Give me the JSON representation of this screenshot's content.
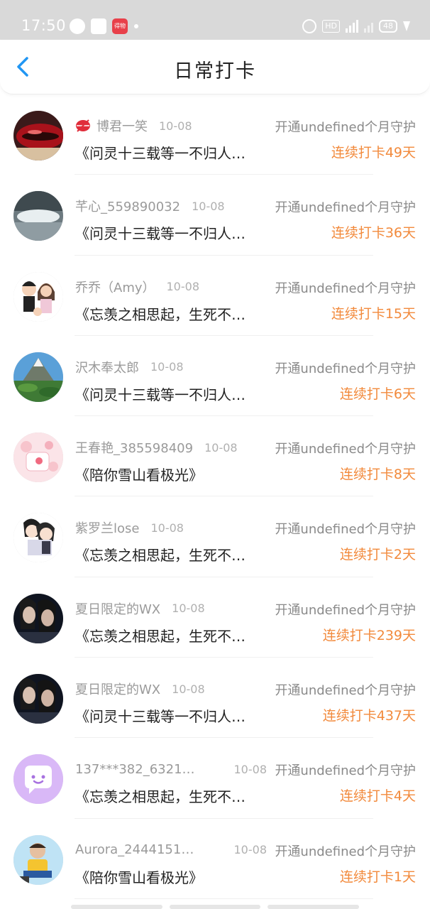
{
  "status_bar": {
    "time": "17:50",
    "hd_label": "HD",
    "battery": "48",
    "notif3_label": "得物"
  },
  "header": {
    "title": "日常打卡"
  },
  "colors": {
    "streak": "#f28a3c",
    "back_arrow": "#2196f3",
    "title": "#222222"
  },
  "items": [
    {
      "username": "博君一笑",
      "date": "10-08",
      "guard": "开通undefined个月守护",
      "book": "《问灵十三载等一不归人…",
      "streak": "连续打卡49天",
      "badge": "lips-icon"
    },
    {
      "username": "芊心_559890032",
      "date": "10-08",
      "guard": "开通undefined个月守护",
      "book": "《问灵十三载等一不归人…",
      "streak": "连续打卡36天"
    },
    {
      "username": "乔乔（Amy）",
      "date": "10-08",
      "guard": "开通undefined个月守护",
      "book": "《忘羡之相思起，生死不…",
      "streak": "连续打卡15天"
    },
    {
      "username": "沢木奉太郎",
      "date": "10-08",
      "guard": "开通undefined个月守护",
      "book": "《问灵十三载等一不归人…",
      "streak": "连续打卡6天"
    },
    {
      "username": "王春艳_385598409",
      "date": "10-08",
      "guard": "开通undefined个月守护",
      "book": "《陪你雪山看极光》",
      "streak": "连续打卡8天"
    },
    {
      "username": "紫罗兰lose",
      "date": "10-08",
      "guard": "开通undefined个月守护",
      "book": "《忘羡之相思起，生死不…",
      "streak": "连续打卡2天"
    },
    {
      "username": "夏日限定的WX",
      "date": "10-08",
      "guard": "开通undefined个月守护",
      "book": "《忘羡之相思起，生死不…",
      "streak": "连续打卡239天"
    },
    {
      "username": "夏日限定的WX",
      "date": "10-08",
      "guard": "开通undefined个月守护",
      "book": "《问灵十三载等一不归人…",
      "streak": "连续打卡437天"
    },
    {
      "username": "137***382_63215…",
      "date": "10-08",
      "guard": "开通undefined个月守护",
      "book": "《忘羡之相思起，生死不…",
      "streak": "连续打卡4天"
    },
    {
      "username": "Aurora_24441512…",
      "date": "10-08",
      "guard": "开通undefined个月守护",
      "book": "《陪你雪山看极光》",
      "streak": "连续打卡1天"
    }
  ]
}
